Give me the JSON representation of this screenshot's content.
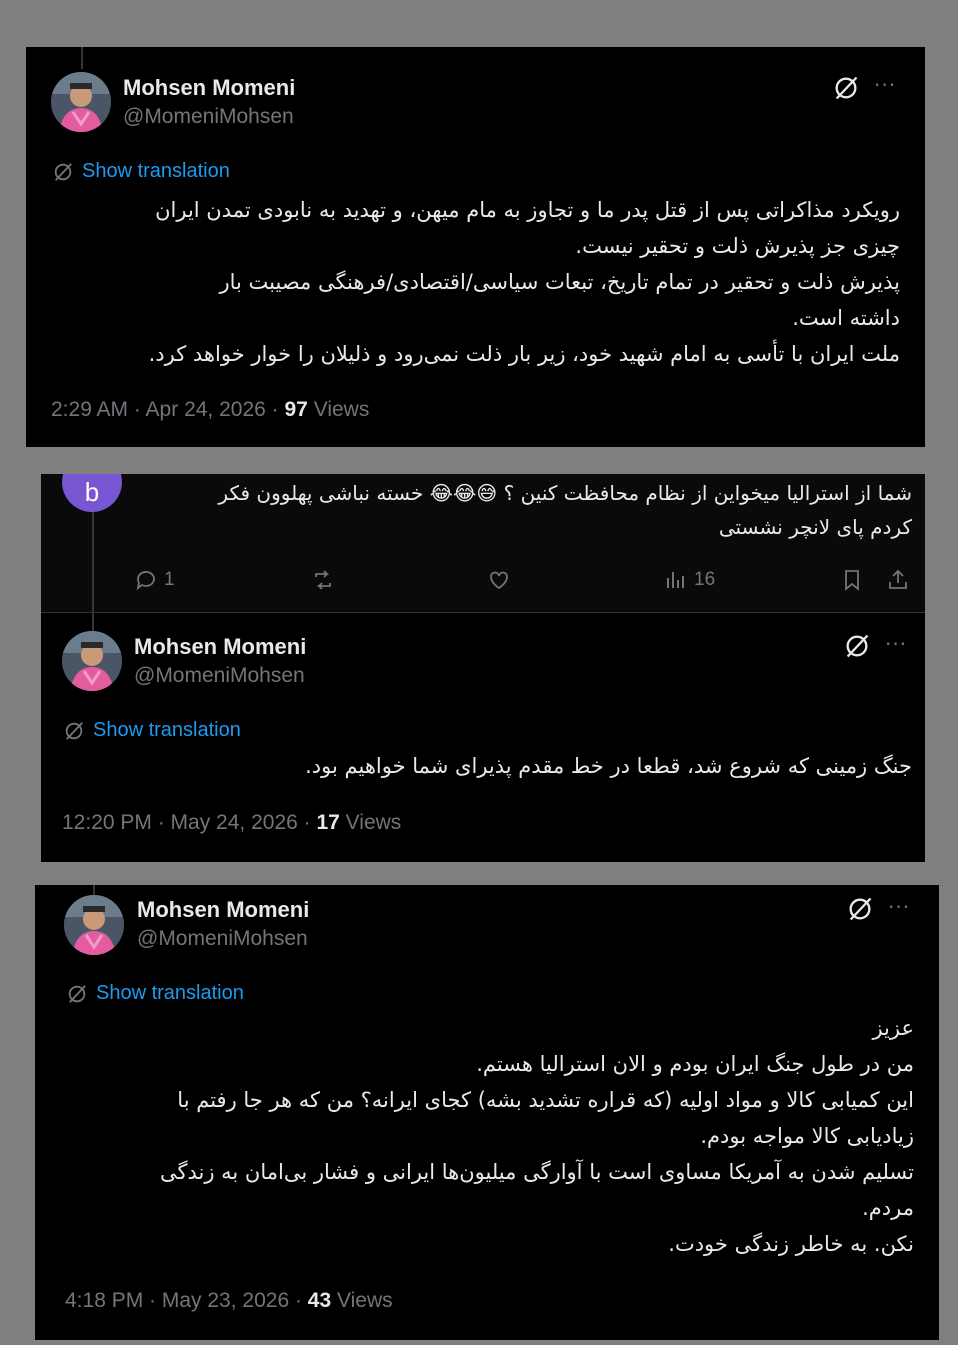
{
  "author": {
    "name": "Mohsen Momeni",
    "handle": "@MomeniMohsen"
  },
  "ui": {
    "show_translation": "Show translation",
    "views_label": "Views",
    "more_glyph": "···"
  },
  "tweets": [
    {
      "lines": [
        "رویکرد مذاکراتی پس از قتل پدر ما و تجاوز به مام میهن، و تهدید به نابودی تمدن ایران",
        "چیزی جز پذیرش ذلت و تحقیر نیست.",
        "پذیرش ذلت و تحقیر در تمام تاریخ، تبعات سیاسی/اقتصادی/فرهنگی مصیبت بار",
        "داشته است.",
        "ملت ایران با تأسی به امام شهید خود، زیر بار ذلت نمی‌رود و ذلیلان را خوار خواهد کرد."
      ],
      "timestamp": "2:29 AM · Apr 24, 2026 · ",
      "views": "97"
    },
    {
      "lines": [
        "جنگ زمینی که شروع شد، قطعا در خط مقدم پذیرای شما خواهیم بود."
      ],
      "timestamp": "12:20 PM · May 24, 2026 · ",
      "views": "17"
    },
    {
      "lines": [
        "عزیز",
        "من در طول جنگ ایران بودم و الان استرالیا هستم.",
        "این کمیابی کالا و مواد اولیه (که قراره تشدید بشه) کجای ایرانه؟ من که هر جا رفتم با",
        "زیادیابی کالا مواجه بودم.",
        "تسلیم شدن به آمریکا مساوی است با آوارگی میلیون‌ها ایرانی و فشار بی‌امان به زندگی",
        "مردم.",
        "نکن. به خاطر زندگی خودت."
      ],
      "timestamp": "4:18 PM · May 23, 2026 · ",
      "views": "43"
    }
  ],
  "reply": {
    "avatar_letter": "b",
    "lines": [
      "شما از استرالیا میخواین از نظام محافظت کنین ؟ 😅😂😂 خسته نباشی پهلوون فکر",
      "کردم پای لانچر نشستی"
    ],
    "replies_count": "1",
    "views_count": "16"
  }
}
